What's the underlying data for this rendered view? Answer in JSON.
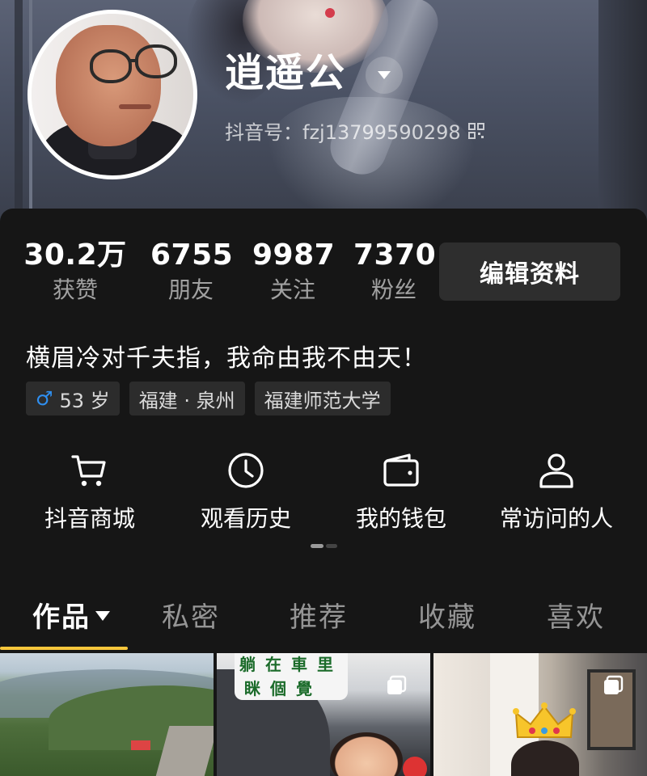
{
  "profile": {
    "name": "逍遥公",
    "douyin_id": "抖音号：fzj13799590298"
  },
  "stats": [
    {
      "value": "30.2万",
      "label": "获赞"
    },
    {
      "value": "6755",
      "label": "朋友"
    },
    {
      "value": "9987",
      "label": "关注"
    },
    {
      "value": "7370",
      "label": "粉丝"
    }
  ],
  "edit_button": "编辑资料",
  "bio": "横眉冷对千夫指，我命由我不由天！",
  "tags": [
    {
      "icon": "male-icon",
      "text": "53 岁"
    },
    {
      "text": "福建 · 泉州"
    },
    {
      "text": "福建师范大学"
    }
  ],
  "shortcuts": [
    {
      "icon": "cart-icon",
      "label": "抖音商城"
    },
    {
      "icon": "clock-icon",
      "label": "观看历史"
    },
    {
      "icon": "wallet-icon",
      "label": "我的钱包"
    },
    {
      "icon": "person-icon",
      "label": "常访问的人"
    }
  ],
  "tabs": [
    {
      "label": "作品",
      "active": true
    },
    {
      "label": "私密"
    },
    {
      "label": "推荐"
    },
    {
      "label": "收藏"
    },
    {
      "label": "喜欢"
    }
  ],
  "grid": {
    "thumb2_text_line1": "躺在車里",
    "thumb2_text_line2": "眯個覺"
  },
  "colors": {
    "accent_underline": "#f9c73c",
    "male_icon": "#2f8ff0",
    "panel_bg": "#161616"
  }
}
